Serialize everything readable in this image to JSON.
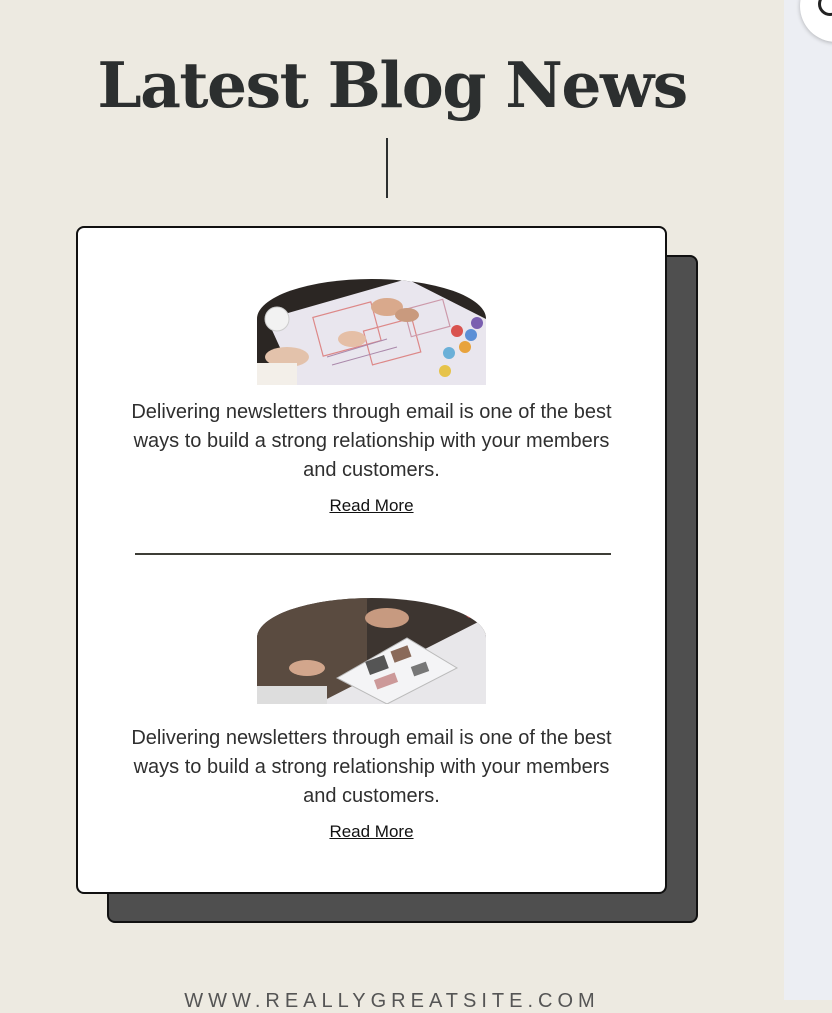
{
  "header": {
    "title": "Latest Blog News"
  },
  "posts": [
    {
      "excerpt": "Delivering newsletters through email is one of the best ways to build a strong relationship with your members and customers.",
      "read_more_label": "Read More"
    },
    {
      "excerpt": "Delivering newsletters through email is one of the best ways to build a strong relationship with your members and customers.",
      "read_more_label": "Read More"
    }
  ],
  "footer": {
    "url_text": "WWW.REALLYGREATSITE.COM"
  },
  "colors": {
    "page_background": "#edeae1",
    "card_background": "#ffffff",
    "card_shadow": "#4f4f4f",
    "heading_text": "#2c2f2f",
    "side_panel": "#eceef3"
  }
}
